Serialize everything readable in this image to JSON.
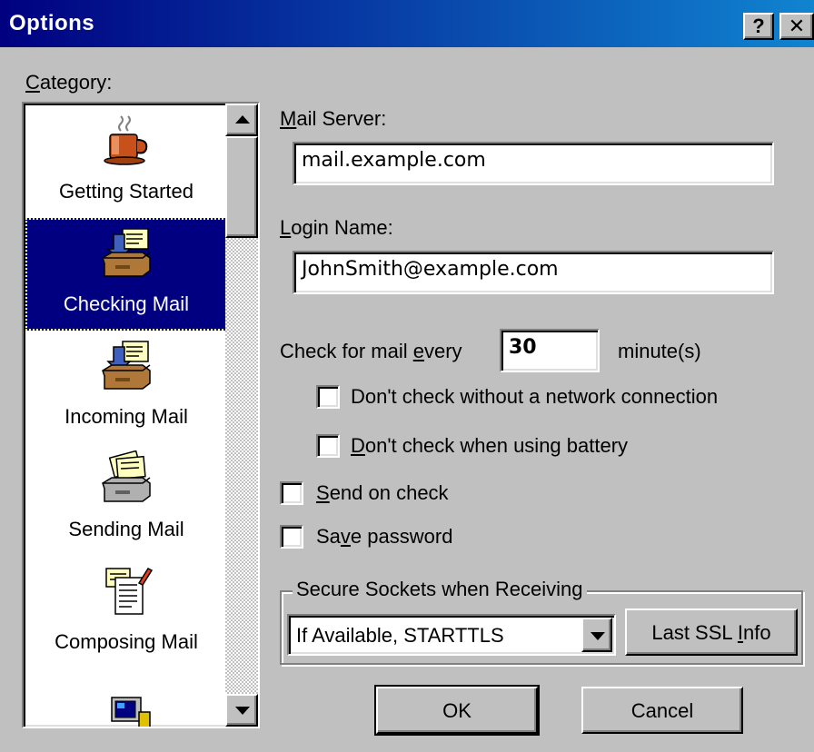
{
  "window": {
    "title": "Options",
    "help_button": "?",
    "close_button": "✕"
  },
  "category": {
    "label": "Category:",
    "items": [
      {
        "label": "Getting Started",
        "icon": "coffee-cup-icon",
        "selected": false
      },
      {
        "label": "Checking Mail",
        "icon": "inbox-tray-icon",
        "selected": true
      },
      {
        "label": "Incoming Mail",
        "icon": "inbox-tray-icon",
        "selected": false
      },
      {
        "label": "Sending Mail",
        "icon": "outbox-tray-icon",
        "selected": false
      },
      {
        "label": "Composing Mail",
        "icon": "compose-document-icon",
        "selected": false
      },
      {
        "label": "",
        "icon": "computer-icon",
        "selected": false
      }
    ]
  },
  "form": {
    "mail_server_label": "Mail Server:",
    "mail_server_value": "mail.example.com",
    "login_name_label": "Login Name:",
    "login_name_value": "JohnSmith@example.com",
    "check_every_label": "Check for mail every",
    "check_every_value": "30",
    "minutes_label": "minute(s)",
    "no_network_label": "Don't check without a network connection",
    "no_network_checked": false,
    "battery_label": "Don't check when using battery",
    "battery_checked": false,
    "send_on_check_label": "Send on check",
    "send_on_check_checked": false,
    "save_password_label": "Save password",
    "save_password_checked": false
  },
  "ssl": {
    "group_title": "Secure Sockets when Receiving",
    "selected_option": "If Available, STARTTLS",
    "last_info_button": "Last SSL Info"
  },
  "buttons": {
    "ok": "OK",
    "cancel": "Cancel"
  },
  "colors": {
    "title_start": "#000080",
    "title_end": "#1084d0",
    "selection": "#000080",
    "face": "#c0c0c0"
  }
}
